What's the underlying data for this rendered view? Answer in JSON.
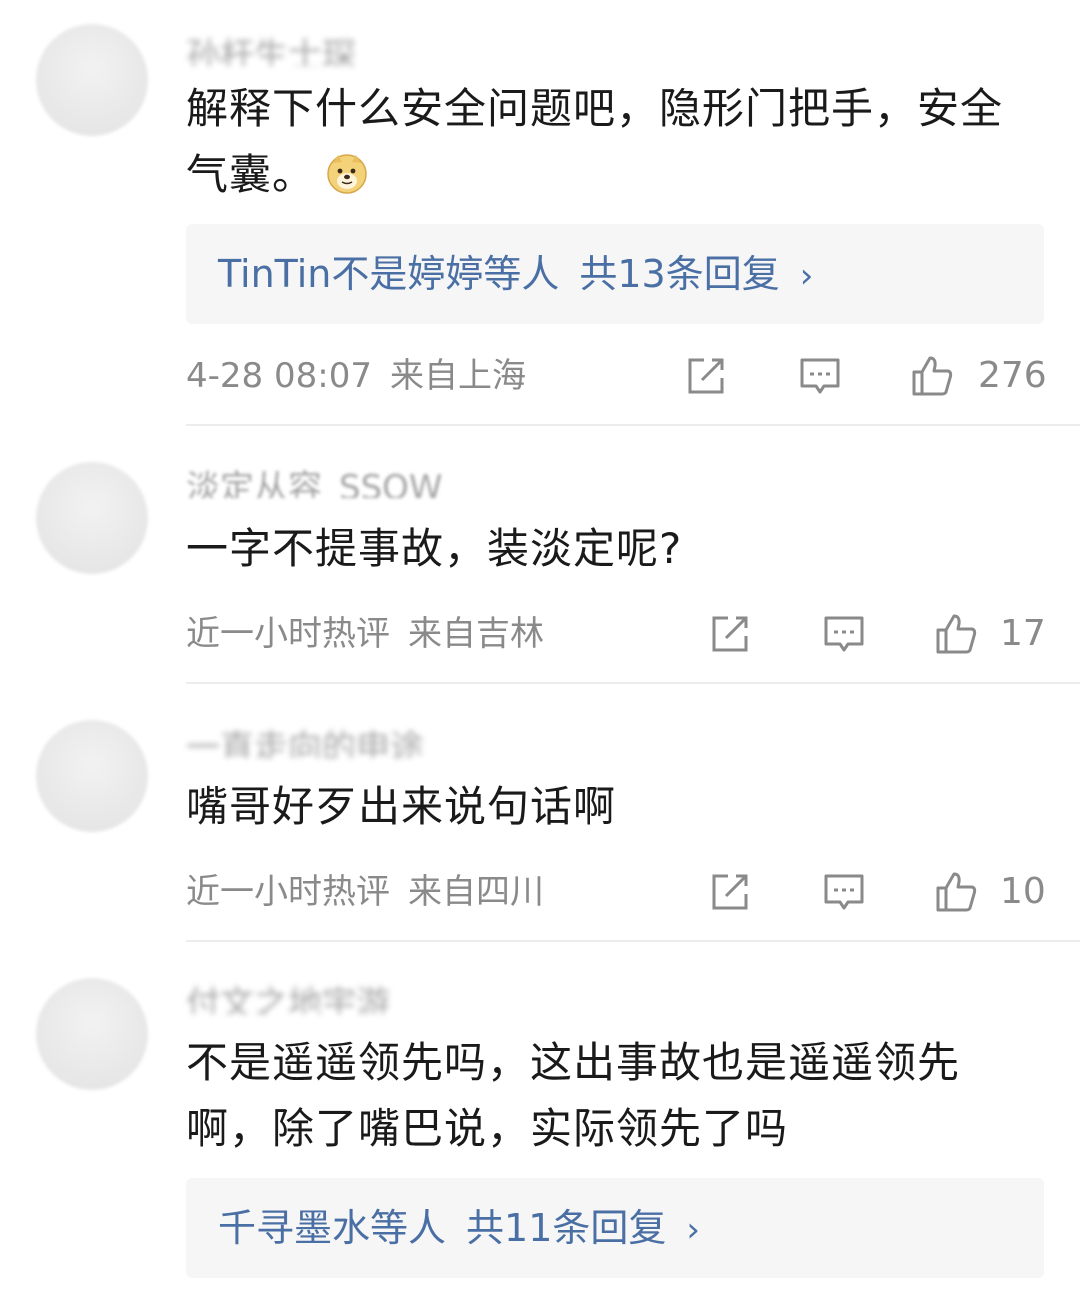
{
  "comments": [
    {
      "username": "孙杆生士琛",
      "text_lines": [
        "解释下什么安全问题吧，隐形门把手，安全",
        "气囊。"
      ],
      "emoji": "doge-emoji",
      "replies": {
        "names": "TinTin不是婷婷等人",
        "count": "共13条回复",
        "chevron": "›"
      },
      "time": "4-28 08:07",
      "location": "来自上海",
      "likes": "276"
    },
    {
      "username": "淡定从容_SSOW",
      "text_lines": [
        "一字不提事故，装淡定呢?"
      ],
      "time": "近一小时热评",
      "location": "来自吉林",
      "likes": "17"
    },
    {
      "username": "一直走向的申途",
      "text_lines": [
        "嘴哥好歹出来说句话啊"
      ],
      "time": "近一小时热评",
      "location": "来自四川",
      "likes": "10"
    },
    {
      "username": "付文之地宇游",
      "text_lines": [
        "不是遥遥领先吗，这出事故也是遥遥领先",
        "啊，除了嘴巴说，实际领先了吗"
      ],
      "replies": {
        "names": "千寻墨水等人",
        "count": "共11条回复",
        "chevron": "›"
      }
    }
  ],
  "icons": {
    "share": "share-icon",
    "comment": "comment-icon",
    "like": "thumbs-up-icon"
  },
  "colors": {
    "link": "#4a6fa5",
    "meta": "#8a8a8a",
    "reply_bg": "#f6f6f6"
  }
}
